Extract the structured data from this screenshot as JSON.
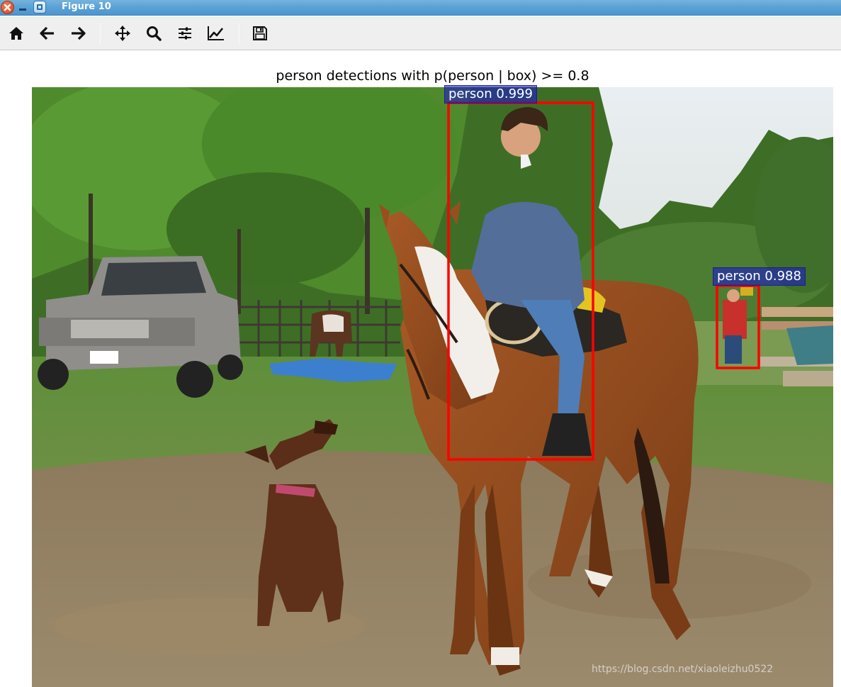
{
  "window": {
    "title": "Figure 10"
  },
  "toolbar": {
    "buttons": [
      {
        "name": "home-icon"
      },
      {
        "name": "back-arrow-icon"
      },
      {
        "name": "forward-arrow-icon"
      },
      {
        "name": "pan-move-icon"
      },
      {
        "name": "zoom-magnifier-icon"
      },
      {
        "name": "configure-subplots-icon"
      },
      {
        "name": "edit-axis-curve-icon"
      },
      {
        "name": "save-floppy-icon"
      }
    ]
  },
  "figure": {
    "title": "person detections with p(person | box) >= 0.8",
    "detections": [
      {
        "label": "person 0.999"
      },
      {
        "label": "person 0.988"
      }
    ],
    "watermark": "https://blog.csdn.net/xiaoleizhu0522",
    "colors": {
      "box": "#ff0000",
      "label_bg": "#1c1cbe"
    }
  }
}
